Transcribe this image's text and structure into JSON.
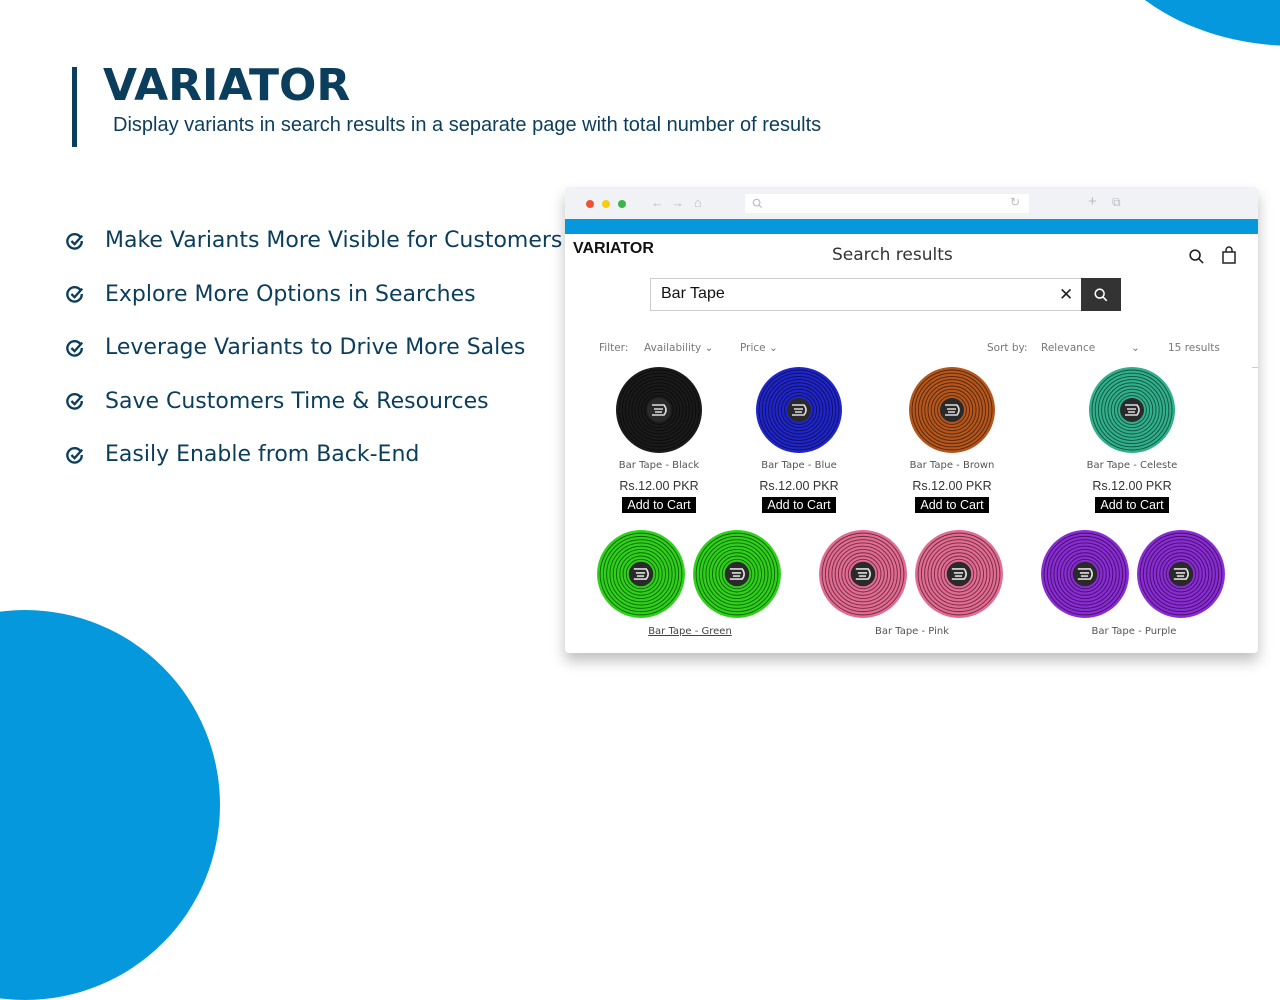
{
  "slide": {
    "title": "VARIATOR",
    "subtitle": "Display variants in search results in a separate page with total number of results",
    "accent_color": "#0698dd",
    "text_color": "#0b3d5c",
    "features": [
      {
        "icon": "check-circle-icon",
        "text": "Make Variants More Visible for Customers"
      },
      {
        "icon": "check-circle-icon",
        "text": "Explore More Options in Searches"
      },
      {
        "icon": "check-circle-icon",
        "text": "Leverage Variants to Drive More Sales"
      },
      {
        "icon": "check-circle-icon",
        "text": "Save Customers Time & Resources"
      },
      {
        "icon": "check-circle-icon",
        "text": "Easily Enable from Back-End"
      }
    ]
  },
  "browser": {
    "url": "",
    "store": {
      "logo": "VARIATOR",
      "page_title": "Search results",
      "search": {
        "value": "Bar Tape",
        "placeholder": "Search"
      },
      "filter_label": "Filter:",
      "filters": [
        "Availability",
        "Price"
      ],
      "sort_label": "Sort by:",
      "sort_value": "Relevance",
      "results_count": "15 results",
      "add_to_cart_label": "Add to Cart",
      "products_row1": [
        {
          "name": "Bar Tape - Black",
          "price": "Rs.12.00 PKR",
          "color": "#1a1a1a"
        },
        {
          "name": "Bar Tape - Blue",
          "price": "Rs.12.00 PKR",
          "color": "#1f25c9"
        },
        {
          "name": "Bar Tape - Brown",
          "price": "Rs.12.00 PKR",
          "color": "#b5561c"
        },
        {
          "name": "Bar Tape - Celeste",
          "price": "Rs.12.00 PKR",
          "color": "#2fb08a"
        }
      ],
      "products_row2": [
        {
          "name": "Bar Tape - Green",
          "color": "#2ed11a"
        },
        {
          "name": "Bar Tape - Pink",
          "color": "#e46a92"
        },
        {
          "name": "Bar Tape - Purple",
          "color": "#8a2bd6"
        }
      ]
    }
  }
}
